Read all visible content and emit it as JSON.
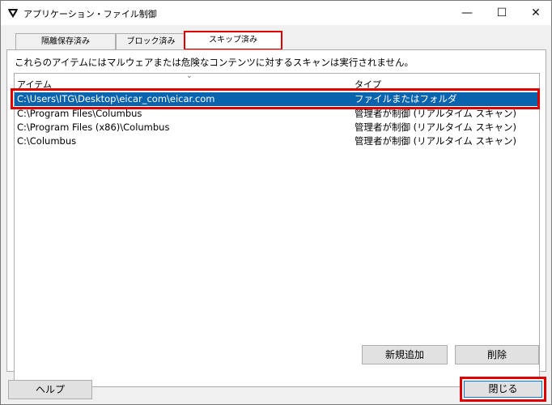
{
  "window": {
    "title": "アプリケーション・ファイル制御",
    "icon": "shield-icon",
    "controls": {
      "minimize": "—",
      "maximize": "☐",
      "close": "✕"
    }
  },
  "tabs": [
    {
      "label": "隔離保存済み"
    },
    {
      "label": "ブロック済み"
    },
    {
      "label": "スキップ済み",
      "active": true
    }
  ],
  "description": "これらのアイテムにはマルウェアまたは危険なコンテンツに対するスキャンは実行されません。",
  "list": {
    "columns": [
      "アイテム",
      "タイプ"
    ],
    "rows": [
      {
        "item": "C:\\Users\\ITG\\Desktop\\eicar_com\\eicar.com",
        "type": "ファイルまたはフォルダ",
        "selected": true
      },
      {
        "item": "C:\\Program Files\\Columbus",
        "type": "管理者が制御 (リアルタイム スキャン)"
      },
      {
        "item": "C:\\Program Files (x86)\\Columbus",
        "type": "管理者が制御 (リアルタイム スキャン)"
      },
      {
        "item": "C:\\Columbus",
        "type": "管理者が制御 (リアルタイム スキャン)"
      }
    ]
  },
  "buttons": {
    "add": "新規追加",
    "delete": "削除",
    "help": "ヘルプ",
    "close": "閉じる"
  },
  "colors": {
    "highlight": "#e00000",
    "selection": "#0a64ad"
  }
}
